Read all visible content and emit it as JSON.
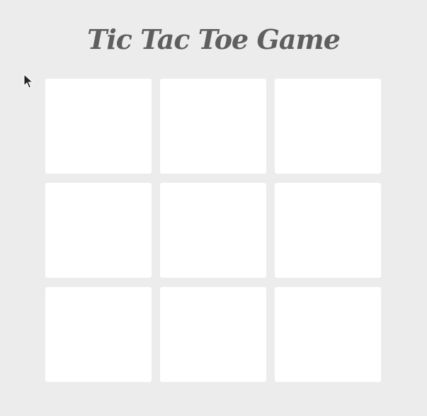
{
  "game": {
    "title": "Tic Tac Toe Game",
    "cells": [
      "",
      "",
      "",
      "",
      "",
      "",
      "",
      "",
      ""
    ]
  },
  "pointer": {
    "icon": "mouse-pointer-icon"
  },
  "colors": {
    "background": "#ececec",
    "cell": "#ffffff",
    "title": "#5f5f5f"
  }
}
